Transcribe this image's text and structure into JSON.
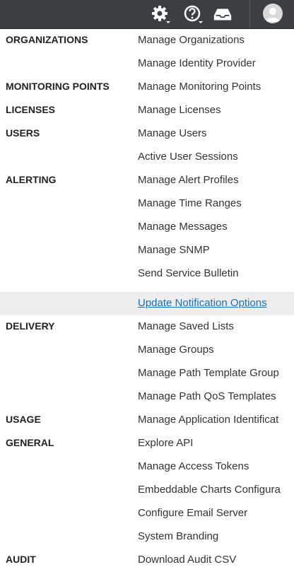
{
  "topbar": {
    "icons": [
      "gear-icon",
      "help-icon",
      "inbox-icon",
      "user-avatar-icon"
    ]
  },
  "menu": {
    "rows": [
      {
        "category": "ORGANIZATIONS",
        "item": "Manage Organizations"
      },
      {
        "category": "",
        "item": "Manage Identity Provider"
      },
      {
        "category": "MONITORING POINTS",
        "item": "Manage Monitoring Points"
      },
      {
        "category": "LICENSES",
        "item": "Manage Licenses"
      },
      {
        "category": "USERS",
        "item": "Manage Users"
      },
      {
        "category": "",
        "item": "Active User Sessions"
      },
      {
        "category": "ALERTING",
        "item": "Manage Alert Profiles"
      },
      {
        "category": "",
        "item": "Manage Time Ranges"
      },
      {
        "category": "",
        "item": "Manage Messages"
      },
      {
        "category": "",
        "item": "Manage SNMP"
      },
      {
        "category": "",
        "item": "Send Service Bulletin"
      },
      {
        "category": "",
        "item": "Update Notification Options"
      },
      {
        "category": "DELIVERY",
        "item": "Manage Saved Lists"
      },
      {
        "category": "",
        "item": "Manage Groups"
      },
      {
        "category": "",
        "item": "Manage Path Template Group"
      },
      {
        "category": "",
        "item": "Manage Path QoS Templates"
      },
      {
        "category": "USAGE",
        "item": "Manage Application Identificat"
      },
      {
        "category": "GENERAL",
        "item": "Explore API"
      },
      {
        "category": "",
        "item": "Manage Access Tokens"
      },
      {
        "category": "",
        "item": "Embeddable Charts Configura"
      },
      {
        "category": "",
        "item": "Configure Email Server"
      },
      {
        "category": "",
        "item": "System Branding"
      },
      {
        "category": "AUDIT",
        "item": "Download Audit CSV"
      }
    ]
  },
  "colors": {
    "topbar": "#3b3f43",
    "link": "#1a6fb3",
    "highlight_row": "#eeeeee"
  }
}
